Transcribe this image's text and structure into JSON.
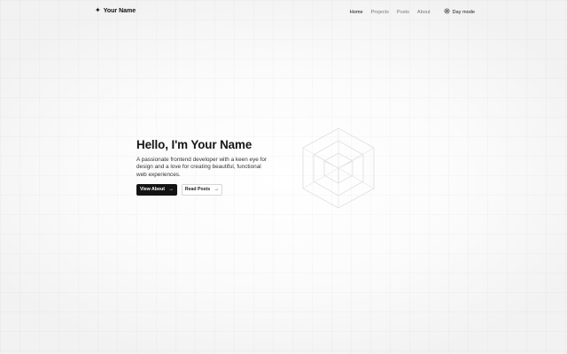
{
  "brand": {
    "icon": "sparkle-icon",
    "name": "Your Name"
  },
  "nav": {
    "items": [
      {
        "label": "Home",
        "active": true
      },
      {
        "label": "Projects",
        "active": false
      },
      {
        "label": "Posts",
        "active": false
      },
      {
        "label": "About",
        "active": false
      }
    ],
    "theme_toggle": {
      "icon": "sun-icon",
      "label": "Day mode"
    }
  },
  "hero": {
    "title": "Hello, I'm Your Name",
    "description": "A passionate frontend developer with a keen eye for design and a love for creating beautiful, functional web experiences.",
    "primary_button": {
      "label": "View About",
      "icon": "arrow-right-icon"
    },
    "secondary_button": {
      "label": "Read Posts",
      "icon": "arrow-right-icon"
    }
  },
  "decoration": {
    "icon": "nested-cube-icon"
  },
  "colors": {
    "background": "#f7f7f7",
    "text": "#161616",
    "muted": "#777777",
    "primary_button_bg": "#141414"
  }
}
